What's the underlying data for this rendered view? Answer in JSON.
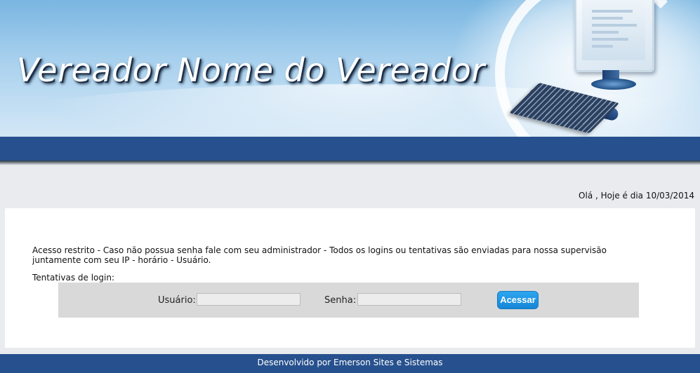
{
  "header": {
    "title": "Vereador Nome do Vereador"
  },
  "greeting": "Olá , Hoje é dia 10/03/2014",
  "notice": "Acesso restrito - Caso não possua senha fale com seu administrador - Todos os logins ou tentativas são enviadas para nossa supervisão juntamente com seu IP - horário - Usuário.",
  "attempts_label": "Tentativas de login:",
  "login": {
    "user_label": "Usuário:",
    "user_value": "",
    "password_label": "Senha:",
    "password_value": "",
    "submit_label": "Acessar"
  },
  "footer": {
    "text": "Desenvolvido por Emerson Sites e Sistemas"
  },
  "colors": {
    "navbar": "#27518e",
    "button": "#1e93e3",
    "banner": "#a9d1ee"
  },
  "icons": {
    "banner_illustration": "computer-illustration"
  }
}
